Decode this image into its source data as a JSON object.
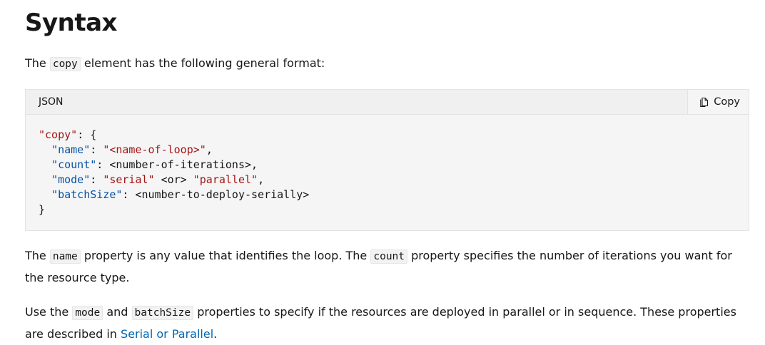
{
  "section": {
    "heading": "Syntax"
  },
  "intro": {
    "before": "The ",
    "code": "copy",
    "after": " element has the following general format:"
  },
  "code_block": {
    "language": "JSON",
    "copy_label": "Copy",
    "copy_icon": "copy-icon",
    "lines": [
      {
        "t1": "\"copy\"",
        "t2": ": {"
      },
      {
        "indent": "  ",
        "key": "\"name\"",
        "sep": ": ",
        "str": "\"<name-of-loop>\"",
        "rest": ","
      },
      {
        "indent": "  ",
        "key": "\"count\"",
        "sep": ": ",
        "plain": "<number-of-iterations>,"
      },
      {
        "indent": "  ",
        "key": "\"mode\"",
        "sep": ": ",
        "str": "\"serial\"",
        "mid": " <or> ",
        "str2": "\"parallel\"",
        "rest": ","
      },
      {
        "indent": "  ",
        "key": "\"batchSize\"",
        "sep": ": ",
        "plain": "<number-to-deploy-serially>"
      },
      {
        "close": "}"
      }
    ]
  },
  "para1": {
    "a": "The ",
    "code1": "name",
    "b": " property is any value that identifies the loop. The ",
    "code2": "count",
    "c": " property specifies the number of iterations you want for the resource type."
  },
  "para2": {
    "a": "Use the ",
    "code1": "mode",
    "b": " and ",
    "code2": "batchSize",
    "c": " properties to specify if the resources are deployed in parallel or in sequence. These properties are described in ",
    "link": "Serial or Parallel",
    "d": "."
  }
}
